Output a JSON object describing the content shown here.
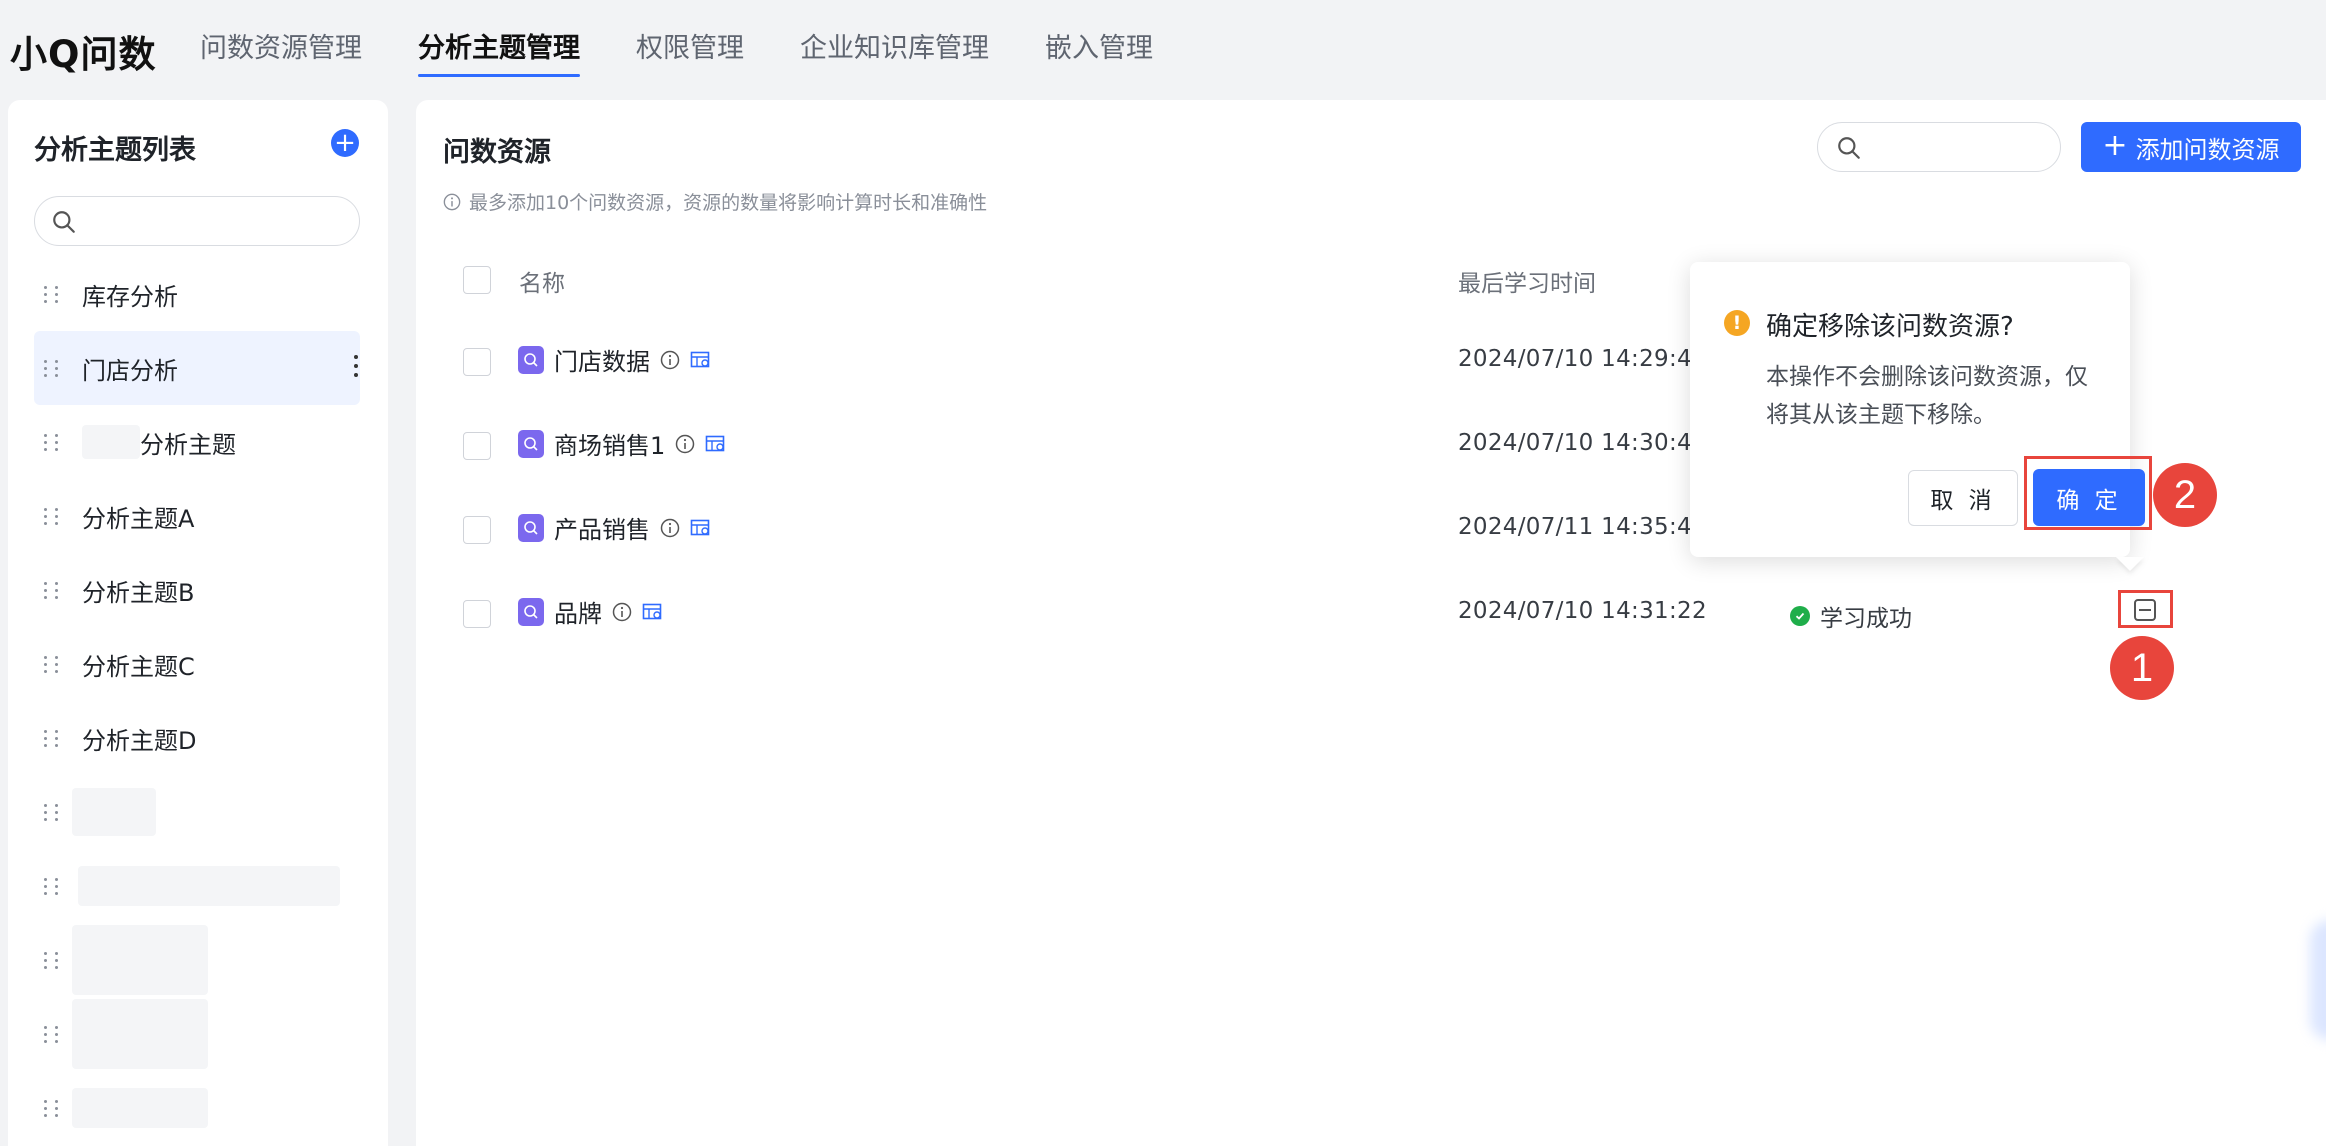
{
  "app": {
    "brand": "小Q问数"
  },
  "nav": {
    "tabs": [
      "问数资源管理",
      "分析主题管理",
      "权限管理",
      "企业知识库管理",
      "嵌入管理"
    ],
    "active_index": 1
  },
  "sidebar": {
    "title": "分析主题列表",
    "add_icon": "plus-circle-icon",
    "items": [
      "库存分析",
      "门店分析",
      "分析主题",
      "分析主题A",
      "分析主题B",
      "分析主题C",
      "分析主题D"
    ],
    "active_index": 1
  },
  "main": {
    "title": "问数资源",
    "tip": "最多添加10个问数资源，资源的数量将影响计算时长和准确性",
    "add_button": "添加问数资源",
    "columns": {
      "name": "名称",
      "last_learn_time": "最后学习时间"
    },
    "rows": [
      {
        "name": "门店数据",
        "time": "2024/07/10 14:29:49"
      },
      {
        "name": "商场销售1",
        "time": "2024/07/10 14:30:44"
      },
      {
        "name": "产品销售",
        "time": "2024/07/11 14:35:47"
      },
      {
        "name": "品牌",
        "time": "2024/07/10 14:31:22",
        "status": "学习成功"
      }
    ]
  },
  "popconfirm": {
    "title": "确定移除该问数资源?",
    "description": "本操作不会删除该问数资源，仅将其从该主题下移除。",
    "cancel": "取 消",
    "ok": "确 定"
  },
  "annotations": {
    "step1": "1",
    "step2": "2"
  },
  "colors": {
    "primary": "#2f6bff",
    "annotation": "#e8453c",
    "warning": "#f5a623",
    "success": "#1fae4a"
  }
}
